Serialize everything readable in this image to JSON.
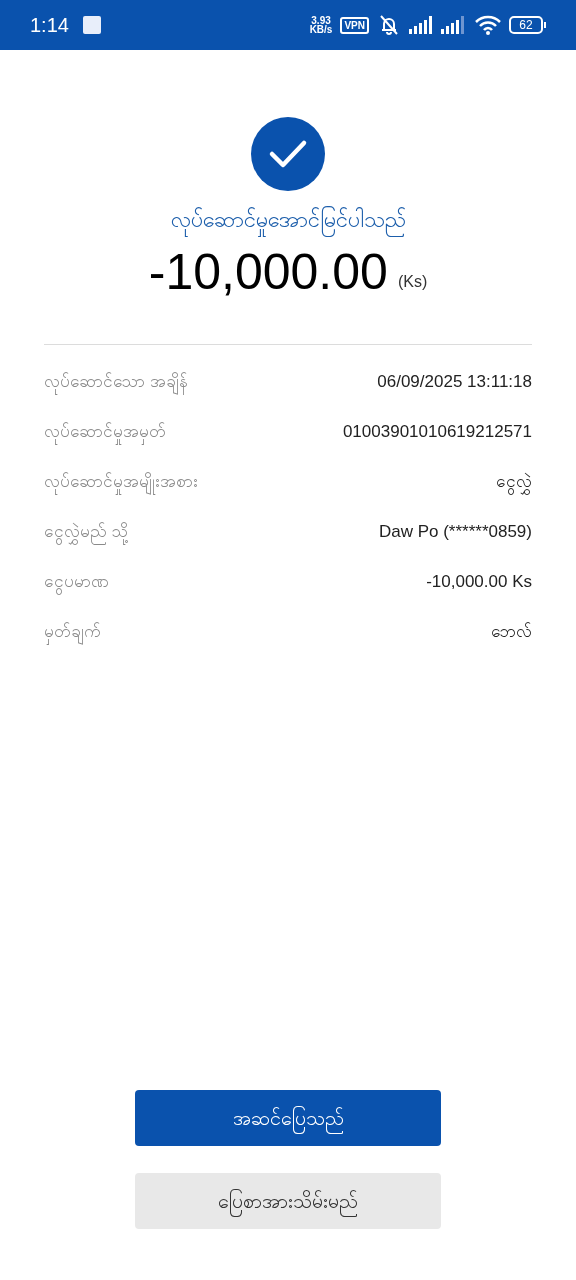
{
  "status_bar": {
    "time": "1:14",
    "net_speed": "3.93",
    "net_unit": "KB/s",
    "vpn": "VPN",
    "battery": "62"
  },
  "result": {
    "title": "လုပ်ဆောင်မှုအောင်မြင်ပါသည်",
    "amount": "-10,000.00",
    "currency": "(Ks)"
  },
  "details": [
    {
      "label": "လုပ်ဆောင်သော အချိန်",
      "value": "06/09/2025 13:11:18"
    },
    {
      "label": "လုပ်ဆောင်မှုအမှတ်",
      "value": "01003901010619212571"
    },
    {
      "label": "လုပ်ဆောင်မှုအမျိုးအစား",
      "value": "ငွေလွှဲ"
    },
    {
      "label": "ငွေလွှဲမည် သို့",
      "value": "Daw Po (******0859)"
    },
    {
      "label": "ငွေပမာဏ",
      "value": "-10,000.00 Ks"
    },
    {
      "label": "မှတ်ချက်",
      "value": "ဘေလ်"
    }
  ],
  "buttons": [
    {
      "label": "အဆင်ပြေသည်",
      "kind": "primary"
    },
    {
      "label": "ပြေစာအားသိမ်းမည်",
      "kind": "secondary"
    }
  ]
}
